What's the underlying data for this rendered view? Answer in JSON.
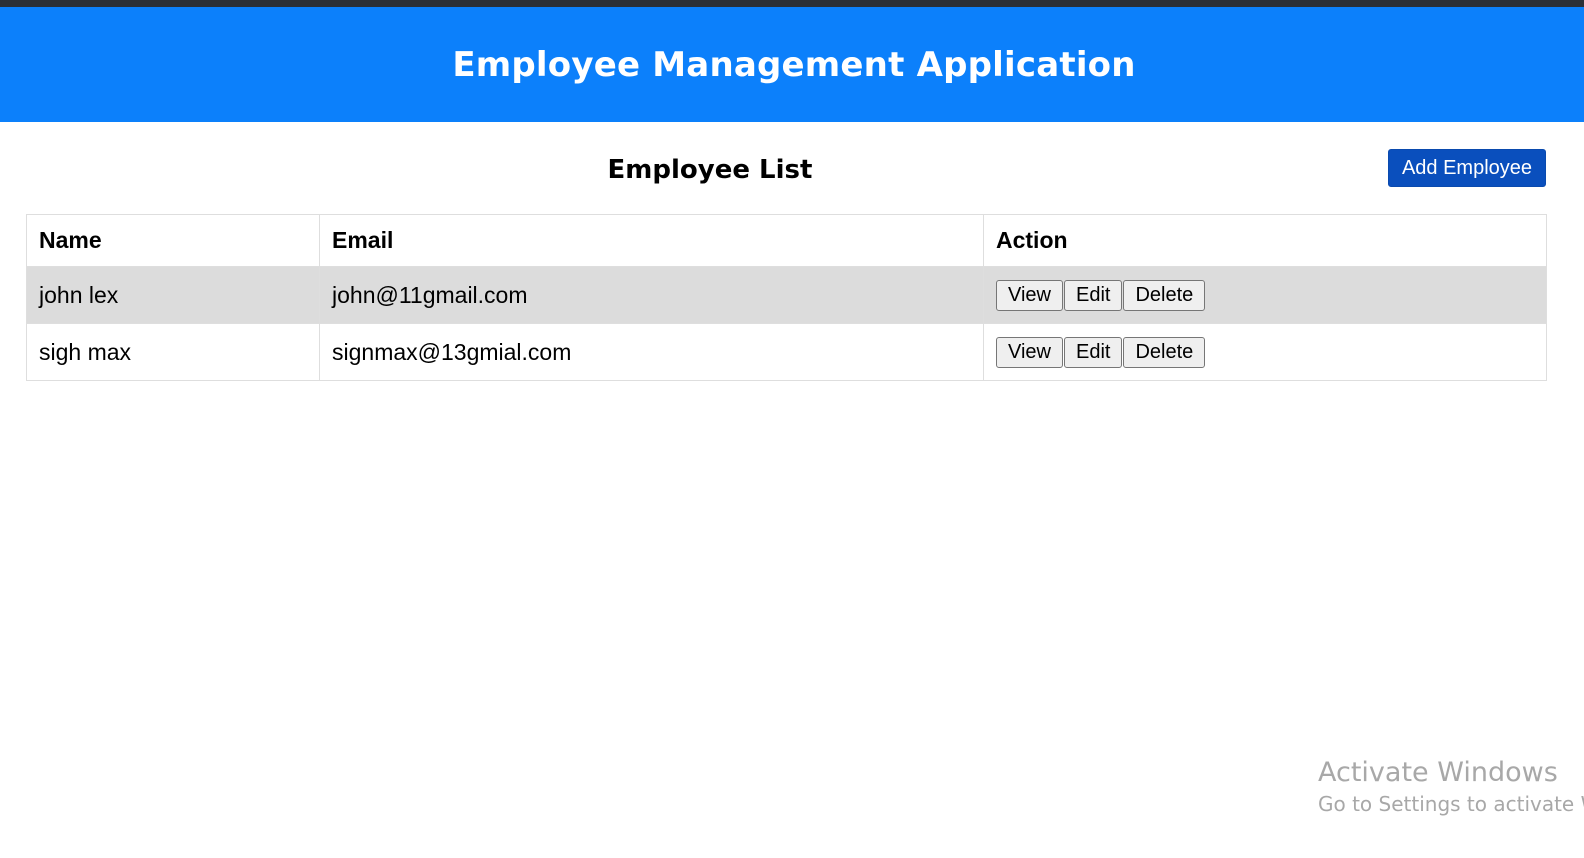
{
  "header": {
    "title": "Employee Management Application",
    "color": "#0c80fb"
  },
  "list": {
    "title": "Employee List",
    "add_button_label": "Add Employee",
    "add_button_color": "#0a4fbd"
  },
  "table": {
    "columns": [
      "Name",
      "Email",
      "Action"
    ],
    "rows": [
      {
        "name": "john lex",
        "email": "john@11gmail.com"
      },
      {
        "name": "sigh max",
        "email": "signmax@13gmial.com"
      }
    ],
    "actions": [
      "View",
      "Edit",
      "Delete"
    ]
  },
  "watermark": {
    "title": "Activate Windows",
    "subtitle": "Go to Settings to activate Windows."
  }
}
